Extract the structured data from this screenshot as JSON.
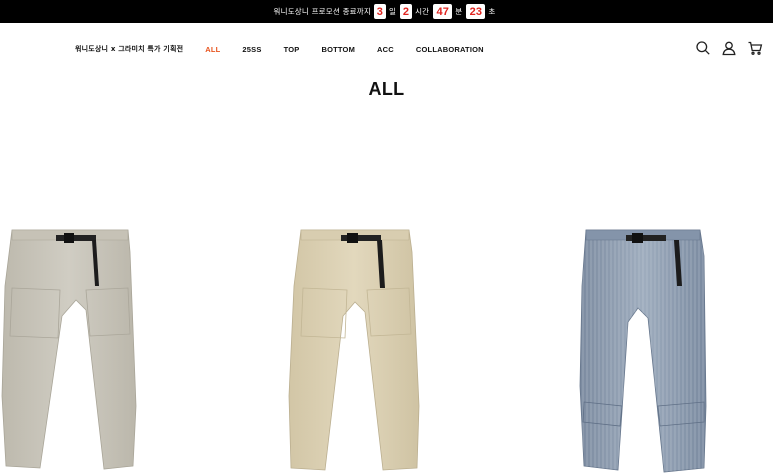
{
  "promo": {
    "prefix": "워니도상니 프로모션 종료까지",
    "days": "3",
    "days_unit": "일",
    "hours": "2",
    "hours_unit": "시간",
    "minutes": "47",
    "minutes_unit": "분",
    "seconds": "23",
    "seconds_unit": "초"
  },
  "nav": {
    "collab_label": "워니도상니 x 그라미치 특가 기획전",
    "items": [
      {
        "label": "ALL",
        "active": true
      },
      {
        "label": "25SS",
        "active": false
      },
      {
        "label": "TOP",
        "active": false
      },
      {
        "label": "BOTTOM",
        "active": false
      },
      {
        "label": "ACC",
        "active": false
      },
      {
        "label": "COLLABORATION",
        "active": false
      }
    ]
  },
  "header_icons": [
    "search-icon",
    "user-icon",
    "cart-icon"
  ],
  "page": {
    "title": "ALL"
  },
  "products": [
    {
      "name": "pants-stone",
      "color": "#cbc8bd"
    },
    {
      "name": "pants-beige",
      "color": "#ddd2b5"
    },
    {
      "name": "pants-denim",
      "color": "#8c9bad"
    }
  ],
  "colors": {
    "accent": "#e8541e",
    "promo_bg": "#000000",
    "countdown_number": "#e0241f"
  }
}
